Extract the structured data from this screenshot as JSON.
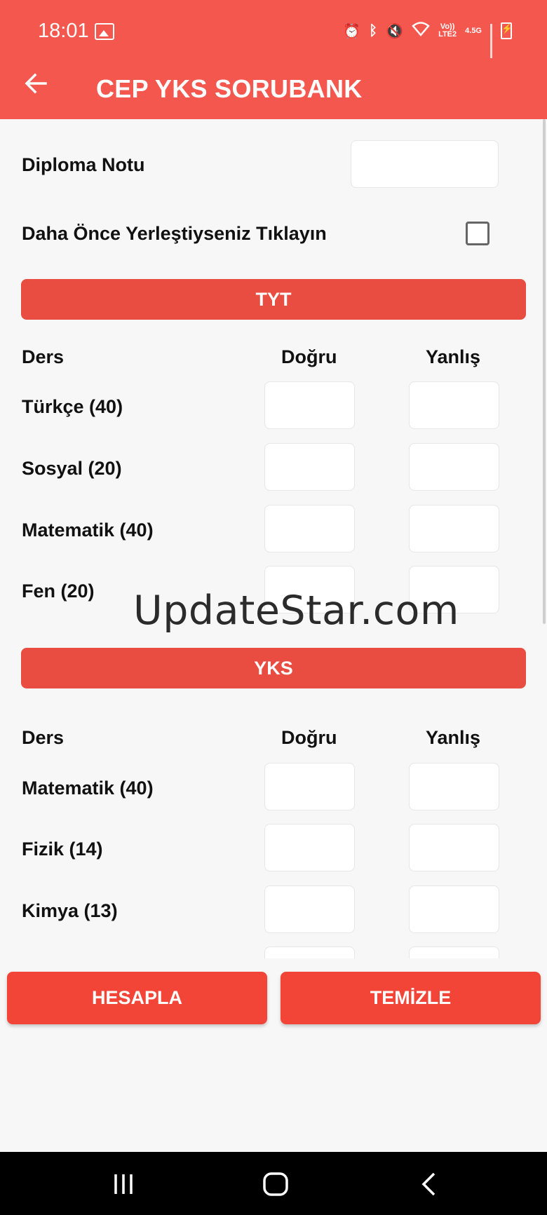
{
  "status_bar": {
    "time": "18:01",
    "network_top": "Vo))",
    "network_bottom": "LTE2",
    "net_type": "4.5G",
    "icons": [
      "image-icon",
      "alarm-icon",
      "bluetooth-icon",
      "mute-icon",
      "wifi-icon",
      "signal-icon",
      "battery-charging-icon"
    ]
  },
  "app_bar": {
    "title": "CEP YKS SORUBANK",
    "back_icon": "arrow-left-icon"
  },
  "form": {
    "diploma_label": "Diploma Notu",
    "diploma_value": "",
    "placed_label": "Daha Önce Yerleştiyseniz Tıklayın",
    "placed_checked": false
  },
  "tyt": {
    "title": "TYT",
    "col_ders": "Ders",
    "col_dogru": "Doğru",
    "col_yanlis": "Yanlış",
    "rows": [
      {
        "label": "Türkçe (40)"
      },
      {
        "label": "Sosyal (20)"
      },
      {
        "label": "Matematik (40)"
      },
      {
        "label": "Fen (20)"
      }
    ]
  },
  "yks": {
    "title": "YKS",
    "col_ders": "Ders",
    "col_dogru": "Doğru",
    "col_yanlis": "Yanlış",
    "rows": [
      {
        "label": "Matematik (40)"
      },
      {
        "label": "Fizik (14)"
      },
      {
        "label": "Kimya (13)"
      }
    ]
  },
  "watermark": "UpdateStar.com",
  "actions": {
    "calculate": "HESAPLA",
    "clear": "TEMİZLE"
  },
  "colors": {
    "primary": "#f4574d",
    "section": "#e94c40",
    "button": "#f24538",
    "background": "#f7f7f7"
  }
}
